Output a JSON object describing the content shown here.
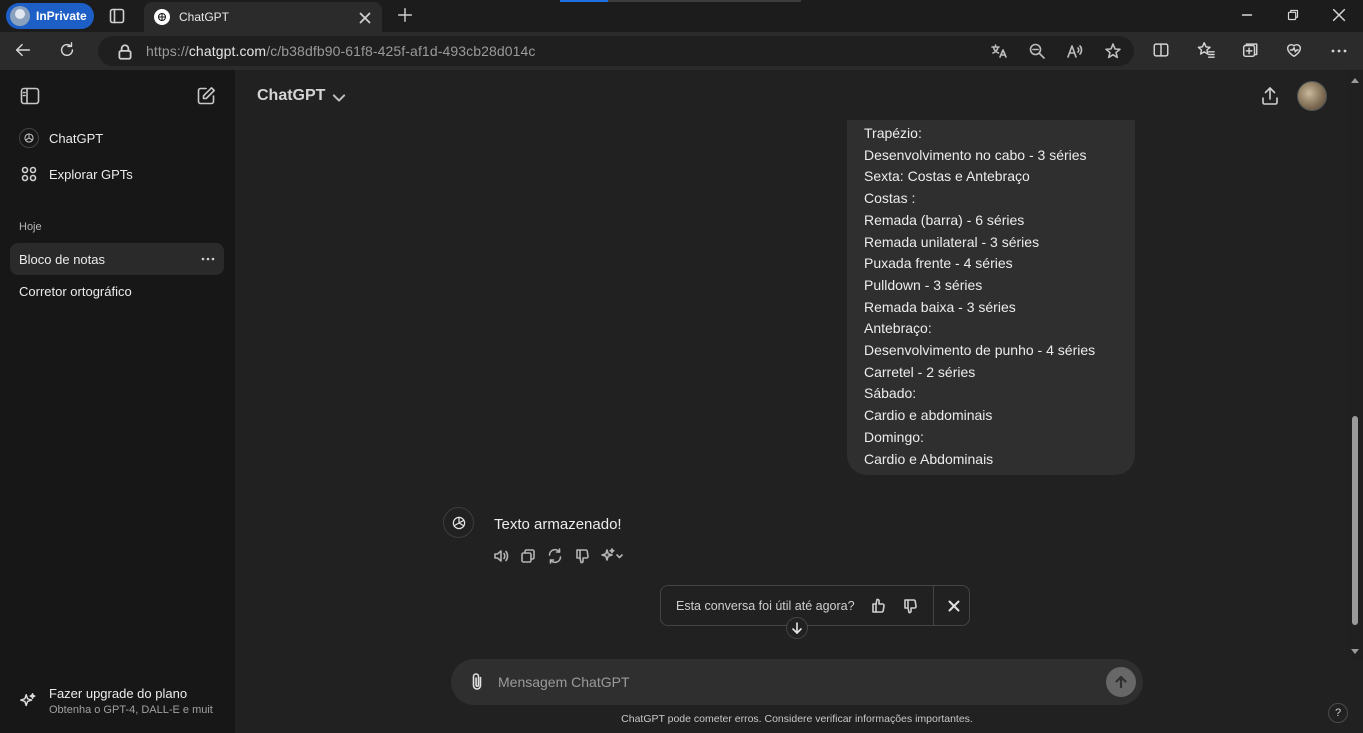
{
  "browser": {
    "inprivate_label": "InPrivate",
    "tab_title": "ChatGPT",
    "url_prefix": "https://",
    "url_host": "chatgpt.com",
    "url_path": "/c/b38dfb90-61f8-425f-af1d-493cb28d014c",
    "load_progress": 0.2
  },
  "sidebar": {
    "items": [
      {
        "label": "ChatGPT",
        "icon": "chatgpt-logo-icon"
      },
      {
        "label": "Explorar GPTs",
        "icon": "grid-icon"
      }
    ],
    "section": "Hoje",
    "chats": [
      {
        "label": "Bloco de notas",
        "active": true
      },
      {
        "label": "Corretor ortográfico",
        "active": false
      }
    ],
    "upgrade": {
      "title": "Fazer upgrade do plano",
      "subtitle": "Obtenha o GPT-4, DALL-E e muit..."
    }
  },
  "header": {
    "model": "ChatGPT"
  },
  "conversation": {
    "user_message_lines": [
      "Trapézio:",
      "Desenvolvimento no cabo - 3 séries",
      "Sexta: Costas e Antebraço",
      "Costas :",
      "Remada (barra) - 6 séries",
      "Remada unilateral - 3 séries",
      "Puxada frente - 4 séries",
      "Pulldown - 3 séries",
      "Remada baixa - 3 séries",
      "Antebraço:",
      "Desenvolvimento de punho - 4 séries",
      "Carretel - 2 séries",
      "Sábado:",
      "Cardio e abdominais",
      "Domingo:",
      "Cardio e Abdominais"
    ],
    "assistant_message": "Texto armazenado!"
  },
  "feedback": {
    "question": "Esta conversa foi útil até agora?"
  },
  "composer": {
    "placeholder": "Mensagem ChatGPT",
    "disclaimer": "ChatGPT pode cometer erros. Considere verificar informações importantes.",
    "help": "?"
  },
  "colors": {
    "sidebar_bg": "#171717",
    "main_bg": "#212121",
    "bubble_bg": "#2f2f2f",
    "inprivate_blue": "#1d5fc7"
  }
}
